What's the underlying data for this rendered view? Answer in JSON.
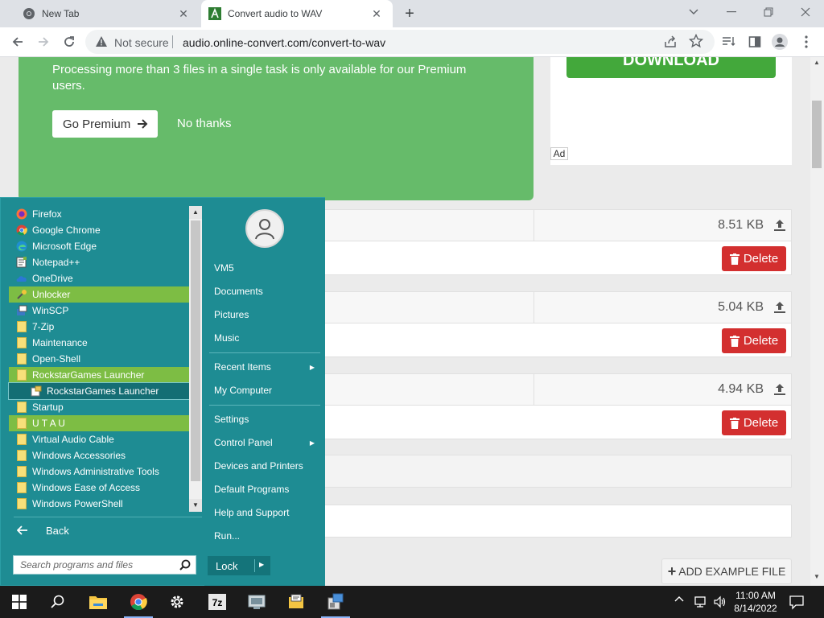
{
  "browser": {
    "tabs": [
      {
        "label": "New Tab",
        "icon": "chrome-icon",
        "active": false
      },
      {
        "label": "Convert audio to WAV",
        "icon": "site-favicon-icon",
        "active": true
      }
    ],
    "new_tab_symbol": "+",
    "security_label": "Not secure",
    "url": "audio.online-convert.com/convert-to-wav"
  },
  "page": {
    "banner": {
      "text": "Processing more than 3 files in a single task is only available for our Premium users.",
      "premium_button": "Go Premium",
      "no_thanks": "No thanks"
    },
    "ad": {
      "download_label": "DOWNLOAD",
      "ad_label": "Ad"
    },
    "files": [
      {
        "size": "8.51 KB",
        "delete_label": "Delete"
      },
      {
        "size": "5.04 KB",
        "delete_label": "Delete"
      },
      {
        "size": "4.94 KB",
        "delete_label": "Delete"
      }
    ],
    "add_example_label": "ADD EXAMPLE FILE"
  },
  "start_menu": {
    "programs": [
      {
        "label": "Firefox",
        "icon": "firefox-icon",
        "style": "normal"
      },
      {
        "label": "Google Chrome",
        "icon": "chrome-icon",
        "style": "normal"
      },
      {
        "label": "Microsoft Edge",
        "icon": "edge-icon",
        "style": "normal"
      },
      {
        "label": "Notepad++",
        "icon": "notepadpp-icon",
        "style": "normal"
      },
      {
        "label": "OneDrive",
        "icon": "onedrive-icon",
        "style": "normal"
      },
      {
        "label": "Unlocker",
        "icon": "unlocker-icon",
        "style": "highlight"
      },
      {
        "label": "WinSCP",
        "icon": "winscp-icon",
        "style": "normal"
      },
      {
        "label": "7-Zip",
        "icon": "folder-icon",
        "style": "normal"
      },
      {
        "label": "Maintenance",
        "icon": "folder-icon",
        "style": "normal"
      },
      {
        "label": "Open-Shell",
        "icon": "folder-icon",
        "style": "normal"
      },
      {
        "label": "RockstarGames Launcher",
        "icon": "folder-icon",
        "style": "highlight"
      },
      {
        "label": "RockstarGames Launcher",
        "icon": "launcher-icon",
        "style": "selected-sub"
      },
      {
        "label": "Startup",
        "icon": "folder-icon",
        "style": "normal"
      },
      {
        "label": "U T A U",
        "icon": "folder-icon",
        "style": "highlight"
      },
      {
        "label": "Virtual Audio Cable",
        "icon": "folder-icon",
        "style": "normal"
      },
      {
        "label": "Windows Accessories",
        "icon": "folder-icon",
        "style": "normal"
      },
      {
        "label": "Windows Administrative Tools",
        "icon": "folder-icon",
        "style": "normal"
      },
      {
        "label": "Windows Ease of Access",
        "icon": "folder-icon",
        "style": "normal"
      },
      {
        "label": "Windows PowerShell",
        "icon": "folder-icon",
        "style": "normal"
      }
    ],
    "back_label": "Back",
    "search_placeholder": "Search programs and files",
    "user_icon": "user-avatar-icon",
    "right_items": [
      {
        "label": "VM5",
        "submenu": false
      },
      {
        "label": "Documents",
        "submenu": false
      },
      {
        "label": "Pictures",
        "submenu": false
      },
      {
        "label": "Music",
        "submenu": false
      },
      {
        "label": "Recent Items",
        "submenu": true
      },
      {
        "label": "My Computer",
        "submenu": false
      },
      {
        "label": "Settings",
        "submenu": false
      },
      {
        "label": "Control Panel",
        "submenu": true
      },
      {
        "label": "Devices and Printers",
        "submenu": false
      },
      {
        "label": "Default Programs",
        "submenu": false
      },
      {
        "label": "Help and Support",
        "submenu": false
      },
      {
        "label": "Run...",
        "submenu": false
      }
    ],
    "lock_label": "Lock"
  },
  "taskbar": {
    "apps": [
      "start-icon",
      "search-icon",
      "file-explorer-icon",
      "chrome-icon",
      "settings-icon",
      "7zip-icon",
      "app-icon",
      "winscp-icon",
      "launcher-icon"
    ],
    "time": "11:00 AM",
    "date": "8/14/2022"
  },
  "colors": {
    "banner_green": "#66bb6a",
    "download_green": "#43a83b",
    "delete_red": "#d32f2f",
    "startmenu_teal": "#1e8c93",
    "highlight_green": "#7dbd44"
  }
}
